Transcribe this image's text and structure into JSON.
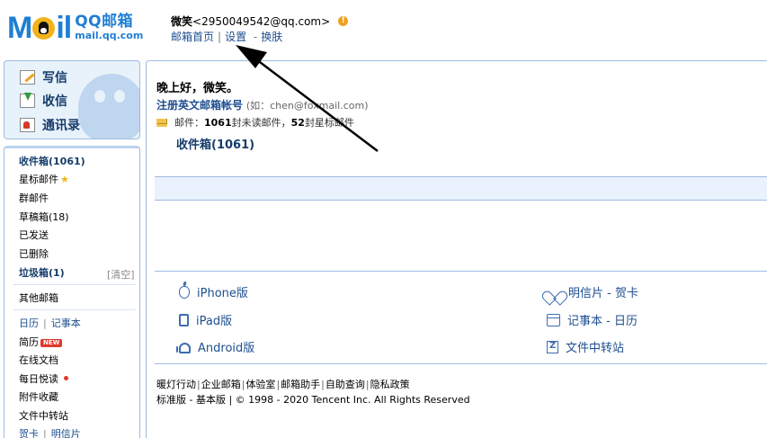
{
  "header": {
    "logo_text": "M  il",
    "logo_cn": "QQ邮箱",
    "logo_url": "mail.qq.com",
    "user_name": "微笑",
    "user_email": "<2950049542@qq.com>",
    "warning_icon": "!",
    "links": {
      "home": "邮箱首页",
      "settings": "设置",
      "dash": "-",
      "skin": "换肤"
    }
  },
  "quick": {
    "write": "写信",
    "receive": "收信",
    "contacts": "通讯录"
  },
  "folders": {
    "inbox": "收件箱(1061)",
    "starred": "星标邮件",
    "group": "群邮件",
    "drafts": "草稿箱(18)",
    "sent": "已发送",
    "deleted": "已删除",
    "spam": "垃圾箱(1)",
    "spam_clear": "[清空]",
    "other": "其他邮箱",
    "calendar": "日历",
    "notes": "记事本",
    "resume": "简历",
    "new_badge": "NEW",
    "docs": "在线文档",
    "daily": "每日悦读",
    "favorites": "附件收藏",
    "transfer": "文件中转站",
    "card": "贺卡",
    "postcard": "明信片"
  },
  "main": {
    "greeting": "晚上好，微笑。",
    "register_link": "注册英文邮箱帐号",
    "register_example": "(如：chen@foxmail.com)",
    "stats_prefix": "邮件：",
    "stats_count": "1061",
    "stats_mid": " 封未读邮件，",
    "stats_starred": "52",
    "stats_suffix": " 封星标邮件",
    "inbox_link": "收件箱(1061)"
  },
  "apps": {
    "iphone": "iPhone版",
    "ipad": "iPad版",
    "android": "Android版",
    "postcard": "明信片 - 贺卡",
    "notes_calendar": "记事本 - 日历",
    "file_transfer": "文件中转站"
  },
  "footer": {
    "links": [
      "暖灯行动",
      "企业邮箱",
      "体验室",
      "邮箱助手",
      "自助查询",
      "隐私政策"
    ],
    "standard": "标准版",
    "dash": " - ",
    "basic": "基本版",
    "copyright": " | © 1998 - 2020 Tencent Inc. All Rights Reserved"
  }
}
